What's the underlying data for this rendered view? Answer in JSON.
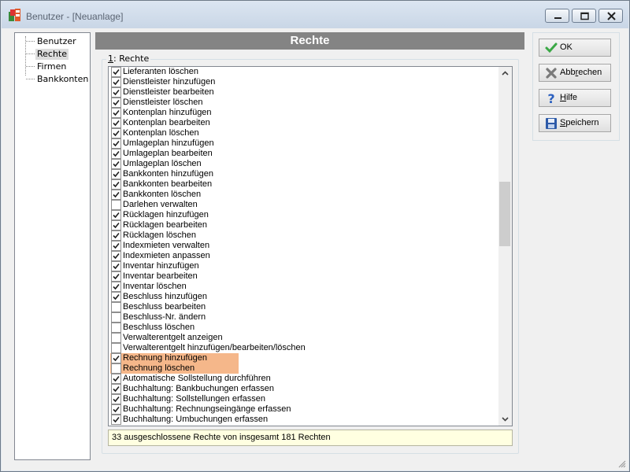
{
  "window": {
    "title": "Benutzer - [Neuanlage]"
  },
  "tree": {
    "items": [
      {
        "label": "Benutzer"
      },
      {
        "label": "Rechte"
      },
      {
        "label": "Firmen"
      },
      {
        "label": "Bankkonten"
      }
    ],
    "selected": "Rechte"
  },
  "panel": {
    "title": "Rechte",
    "group_label_prefix": "1",
    "group_label_rest": ": Rechte"
  },
  "rights": [
    {
      "label": "Lieferanten löschen",
      "checked": true
    },
    {
      "label": "Dienstleister hinzufügen",
      "checked": true
    },
    {
      "label": "Dienstleister bearbeiten",
      "checked": true
    },
    {
      "label": "Dienstleister löschen",
      "checked": true
    },
    {
      "label": "Kontenplan hinzufügen",
      "checked": true
    },
    {
      "label": "Kontenplan bearbeiten",
      "checked": true
    },
    {
      "label": "Kontenplan löschen",
      "checked": true
    },
    {
      "label": "Umlageplan hinzufügen",
      "checked": true
    },
    {
      "label": "Umlageplan bearbeiten",
      "checked": true
    },
    {
      "label": "Umlageplan löschen",
      "checked": true
    },
    {
      "label": "Bankkonten hinzufügen",
      "checked": true
    },
    {
      "label": "Bankkonten bearbeiten",
      "checked": true
    },
    {
      "label": "Bankkonten löschen",
      "checked": true
    },
    {
      "label": "Darlehen verwalten",
      "checked": false
    },
    {
      "label": "Rücklagen hinzufügen",
      "checked": true
    },
    {
      "label": "Rücklagen bearbeiten",
      "checked": true
    },
    {
      "label": "Rücklagen löschen",
      "checked": true
    },
    {
      "label": "Indexmieten verwalten",
      "checked": true
    },
    {
      "label": "Indexmieten anpassen",
      "checked": true
    },
    {
      "label": "Inventar hinzufügen",
      "checked": true
    },
    {
      "label": "Inventar bearbeiten",
      "checked": true
    },
    {
      "label": "Inventar löschen",
      "checked": true
    },
    {
      "label": "Beschluss hinzufügen",
      "checked": true
    },
    {
      "label": "Beschluss bearbeiten",
      "checked": false
    },
    {
      "label": "Beschluss-Nr. ändern",
      "checked": false
    },
    {
      "label": "Beschluss löschen",
      "checked": false
    },
    {
      "label": "Verwalterentgelt anzeigen",
      "checked": false
    },
    {
      "label": "Verwalterentgelt hinzufügen/bearbeiten/löschen",
      "checked": false
    },
    {
      "label": "Rechnung hinzufügen",
      "checked": true,
      "highlight": true
    },
    {
      "label": "Rechnung löschen",
      "checked": false,
      "highlight": true
    },
    {
      "label": "Automatische Sollstellung durchführen",
      "checked": true
    },
    {
      "label": "Buchhaltung: Bankbuchungen erfassen",
      "checked": true
    },
    {
      "label": "Buchhaltung: Sollstellungen erfassen",
      "checked": true
    },
    {
      "label": "Buchhaltung: Rechnungseingänge erfassen",
      "checked": true
    },
    {
      "label": "Buchhaltung: Umbuchungen erfassen",
      "checked": true
    }
  ],
  "status": "33 ausgeschlossene Rechte von insgesamt 181 Rechten",
  "buttons": {
    "ok": {
      "label": "OK"
    },
    "cancel": {
      "label": "Abbrechen"
    },
    "help": {
      "label": "Hilfe"
    },
    "save": {
      "label": "Speichern"
    }
  },
  "colors": {
    "highlight": "#f5b78a",
    "header": "#848484",
    "status_bg": "#ffffe1"
  }
}
